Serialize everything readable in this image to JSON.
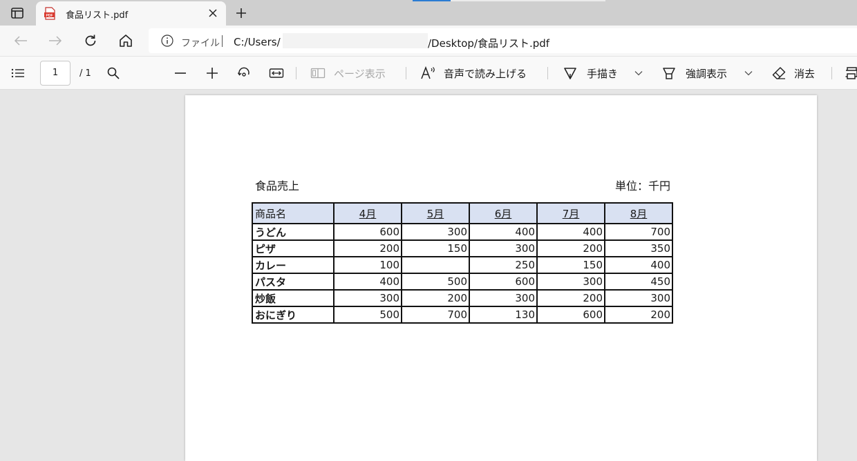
{
  "tab": {
    "title": "食品リスト.pdf",
    "favicon": "pdf-icon"
  },
  "address": {
    "file_label": "ファイル",
    "url_prefix": "C:/Users/",
    "url_suffix": "/Desktop/食品リスト.pdf"
  },
  "toolbar": {
    "page_number": "1",
    "page_total": "/ 1",
    "page_view": "ページ表示",
    "read_aloud": "音声で読み上げる",
    "draw": "手描き",
    "highlight": "強調表示",
    "erase": "消去"
  },
  "document": {
    "title": "食品売上",
    "unit": "単位：千円",
    "table": {
      "headers": [
        "商品名",
        "4月",
        "5月",
        "6月",
        "7月",
        "8月"
      ],
      "rows": [
        [
          "うどん",
          "600",
          "300",
          "400",
          "400",
          "700"
        ],
        [
          "ピザ",
          "200",
          "150",
          "300",
          "200",
          "350"
        ],
        [
          "カレー",
          "100",
          "",
          "250",
          "150",
          "400"
        ],
        [
          "パスタ",
          "400",
          "500",
          "600",
          "300",
          "450"
        ],
        [
          "炒飯",
          "300",
          "200",
          "300",
          "200",
          "300"
        ],
        [
          "おにぎり",
          "500",
          "700",
          "130",
          "600",
          "200"
        ]
      ]
    }
  },
  "colors": {
    "header_fill": "#d9e1f2",
    "accent": "#2b7cd3"
  }
}
